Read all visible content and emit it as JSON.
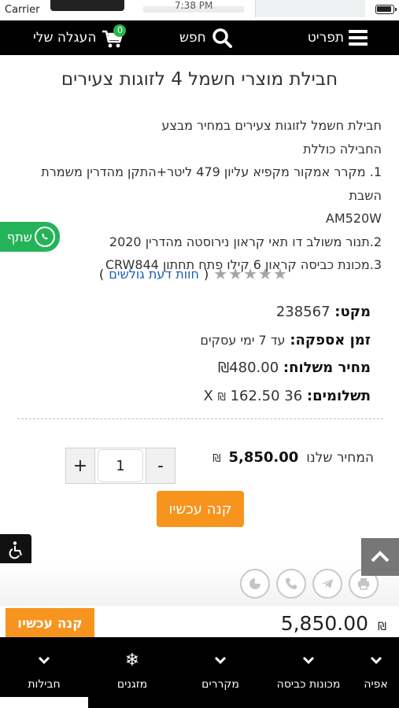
{
  "status_bar": {
    "carrier": "Carrier",
    "time": "7:38 PM"
  },
  "top_nav": {
    "menu_label": "תפריט",
    "search_label": "חפש",
    "cart_label": "העגלה שלי",
    "cart_count": "0"
  },
  "product": {
    "title": "חבילת מוצרי חשמל 4 לזוגות צעירים",
    "description_lines": [
      "חבילת חשמל לזוגות צעירים במחיר מבצע",
      "החבילה כוללת",
      "1. מקרר אמקור מקפיא עליון 479 ליטר+התקן מהדרין משמרת השבת",
      "AM520W",
      "2.תנור משולב דו תאי קראון נירוסטה מהדרין 2020",
      "3.מכונת כביסה קראון 6 קילו פתח תחתון CRW844"
    ],
    "review_link": "חוות דעת גולשים",
    "rating_stars": 0,
    "sku_label": "מקט:",
    "sku_value": "238567",
    "delivery_label": "זמן אספקה:",
    "delivery_value": "עד 7 ימי עסקים",
    "shipping_label": "מחיר משלוח:",
    "shipping_value": "₪480.00",
    "payments_label": "תשלומים:",
    "payments_count": "36",
    "payments_x": "X",
    "payments_currency": "₪",
    "payments_value": "162.50",
    "our_price_label": "המחיר שלנו",
    "price_currency": "₪",
    "price_value": "5,850.00",
    "quantity": "1",
    "qty_plus": "+",
    "qty_minus": "-",
    "buy_now": "קנה עכשיו"
  },
  "share": {
    "label": "שתף",
    "icon": "whatsapp-icon"
  },
  "share_icons": [
    "pie-chart-icon",
    "phone-icon",
    "telegram-icon",
    "print-icon"
  ],
  "sticky_bar": {
    "price": "5,850.00",
    "currency": "₪",
    "buy_label": "קנה עכשיו"
  },
  "bottom_categories": [
    {
      "label": "חבילות",
      "icon": "chevron-down-icon"
    },
    {
      "label": "מזגנים",
      "icon": "snowflake-icon"
    },
    {
      "label": "מקררים",
      "icon": "chevron-down-icon"
    },
    {
      "label": "מכונות כביסה",
      "icon": "chevron-down-icon"
    },
    {
      "label": "אפיה",
      "icon": "chevron-down-icon"
    }
  ],
  "colors": {
    "nav_bg": "#000000",
    "accent_orange": "#f7941e",
    "whatsapp_green": "#25b35a",
    "link_blue": "#1a5fb4",
    "badge_green": "#2db34a"
  }
}
